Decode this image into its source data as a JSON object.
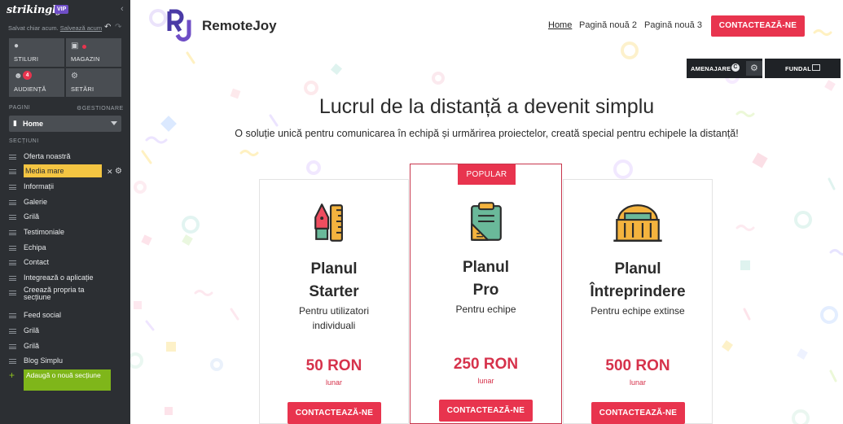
{
  "editor": {
    "logo": "strikingly",
    "vip": "VIP",
    "collapse_icon": "chevron-left-icon",
    "saved_text": "Salvat chiar acum.",
    "saved_link": "Salvează acum",
    "tiles": [
      {
        "label": "STILURI",
        "icon": "palette-icon"
      },
      {
        "label": "MAGAZIN",
        "icon": "bag-icon"
      },
      {
        "label": "AUDIENȚĂ",
        "icon": "users-icon",
        "badge": "4"
      },
      {
        "label": "SETĂRI",
        "icon": "gear-icon"
      }
    ],
    "pages_heading": "PAGINI",
    "manage_label": "GESTIONARE",
    "current_page": "Home",
    "sections_heading": "SECȚIUNI",
    "sections": [
      "Oferta noastră",
      "Media mare",
      "Informații",
      "Galerie",
      "Grilă",
      "Testimoniale",
      "Echipa",
      "Contact",
      "Integrează o aplicație",
      "Creează propria ta secțiune",
      "Feed social",
      "Grilă",
      "Grilă",
      "Blog Simplu"
    ],
    "add_section": "Adaugă o nouă secțiune"
  },
  "site": {
    "brand": "RemoteJoy",
    "brand_mark": "RJ",
    "nav": [
      "Home",
      "Pagină nouă 2",
      "Pagină nouă 3"
    ],
    "nav_cta": "CONTACTEAZĂ-NE",
    "edit_buttons": {
      "layout": "AMENAJARE",
      "layout_badge": "C",
      "background": "FUNDAL"
    },
    "hero_title": "Lucrul de la distanță a devenit simplu",
    "hero_subtitle": "O soluție unică pentru comunicarea în echipă și urmărirea proiectelor, creată special pentru echipele la distanță!",
    "plans": [
      {
        "name_line1": "Planul",
        "name_line2": "Starter",
        "desc_line1": "Pentru utilizatori",
        "desc_line2": "individuali",
        "price": "50 RON",
        "period": "lunar",
        "cta": "CONTACTEAZĂ-NE",
        "icon": "pen-ruler-icon"
      },
      {
        "ribbon": "POPULAR",
        "name_line1": "Planul",
        "name_line2": "Pro",
        "desc_line1": "Pentru echipe",
        "desc_line2": "",
        "price": "250 RON",
        "period": "lunar",
        "cta": "CONTACTEAZĂ-NE",
        "icon": "clipboard-ruler-icon"
      },
      {
        "name_line1": "Planul",
        "name_line2": "Întreprindere",
        "desc_line1": "Pentru echipe extinse",
        "desc_line2": "",
        "price": "500 RON",
        "period": "lunar",
        "cta": "CONTACTEAZĂ-NE",
        "icon": "building-icon"
      }
    ],
    "colors": {
      "accent": "#e8344e",
      "brand": "#6f4ec6",
      "sidebar": "#2c2f33",
      "highlight": "#f4c542",
      "add_green": "#7fb61a"
    }
  }
}
